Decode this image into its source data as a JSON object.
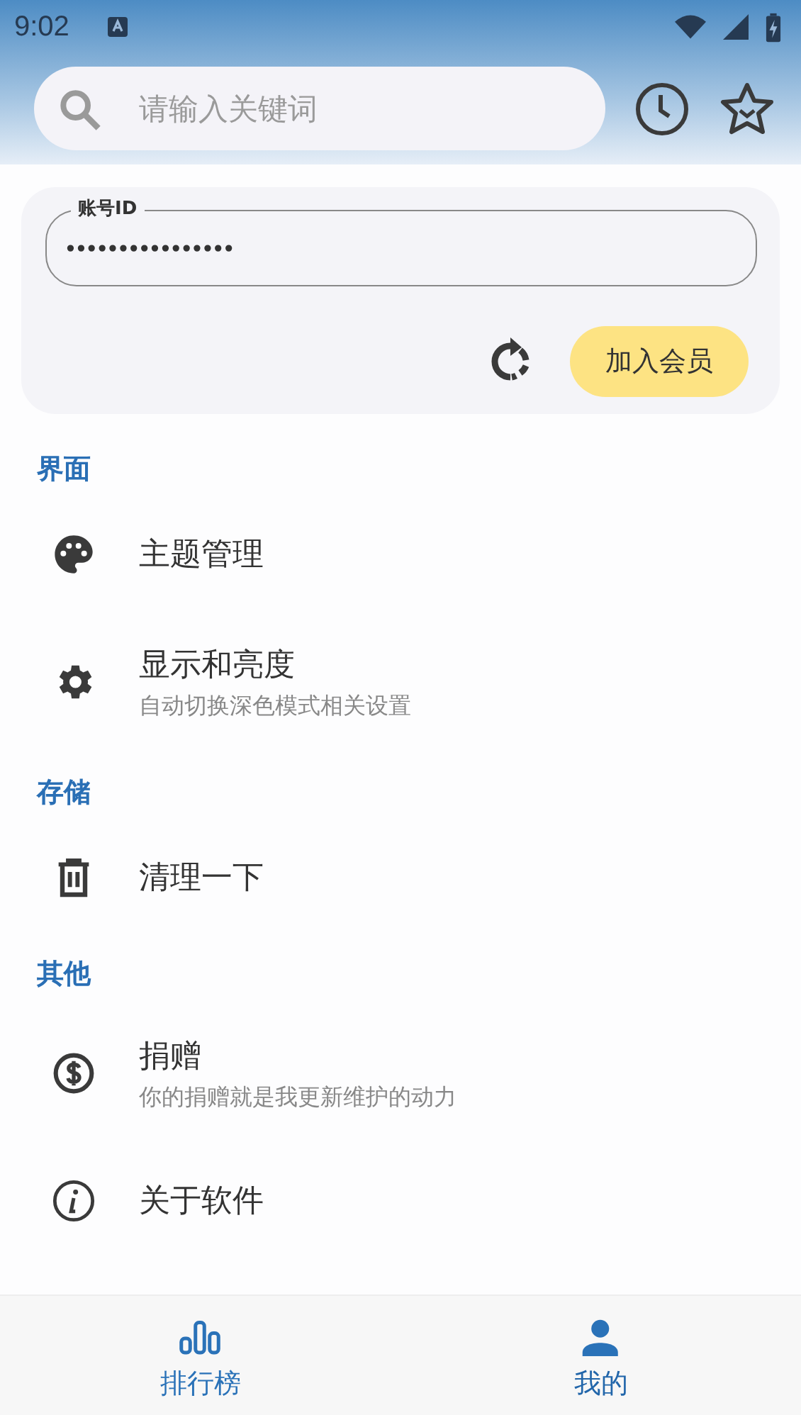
{
  "status_bar": {
    "time": "9:02"
  },
  "search": {
    "placeholder": "请输入关键词"
  },
  "account": {
    "label": "账号ID",
    "value": "••••••••••••••••",
    "join_button": "加入会员"
  },
  "sections": [
    {
      "title": "界面",
      "items": [
        {
          "title": "主题管理"
        },
        {
          "title": "显示和亮度",
          "subtitle": "自动切换深色模式相关设置"
        }
      ]
    },
    {
      "title": "存储",
      "items": [
        {
          "title": "清理一下"
        }
      ]
    },
    {
      "title": "其他",
      "items": [
        {
          "title": "捐赠",
          "subtitle": "你的捐赠就是我更新维护的动力"
        },
        {
          "title": "关于软件"
        }
      ]
    }
  ],
  "nav": [
    {
      "label": "排行榜",
      "selected": false
    },
    {
      "label": "我的",
      "selected": true
    }
  ]
}
